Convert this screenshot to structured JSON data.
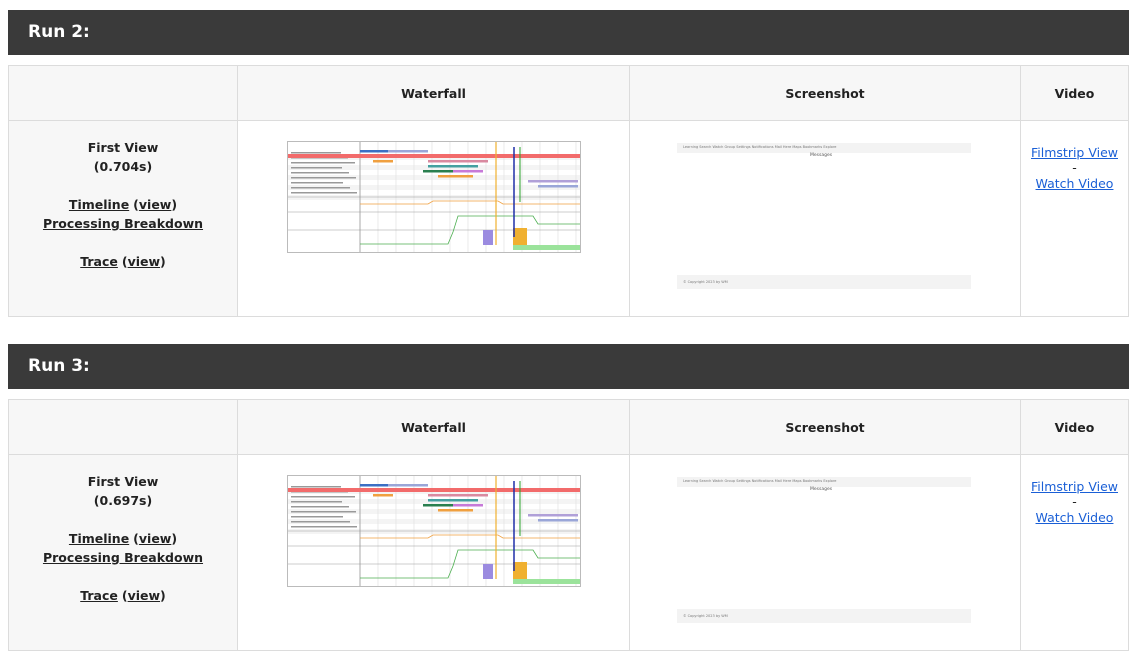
{
  "runs": [
    {
      "title": "Run 2:",
      "headers": {
        "waterfall": "Waterfall",
        "screenshot": "Screenshot",
        "video": "Video"
      },
      "view_label": "First View",
      "time": "(0.704s)",
      "timeline": "Timeline",
      "view_link": "view",
      "processing": "Processing Breakdown",
      "trace": "Trace",
      "filmstrip": "Filmstrip View",
      "dash": "-",
      "watch": "Watch Video",
      "screenshot_nav": "Learning   Search   Watch   Group   Settings   Notifications   Mail Here   Maps   Bookmarks   Explore",
      "screenshot_message": "Messages",
      "screenshot_footer": "© Copyright 2023 by WM"
    },
    {
      "title": "Run 3:",
      "headers": {
        "waterfall": "Waterfall",
        "screenshot": "Screenshot",
        "video": "Video"
      },
      "view_label": "First View",
      "time": "(0.697s)",
      "timeline": "Timeline",
      "view_link": "view",
      "processing": "Processing Breakdown",
      "trace": "Trace",
      "filmstrip": "Filmstrip View",
      "dash": "-",
      "watch": "Watch Video",
      "screenshot_nav": "Learning   Search   Watch   Group   Settings   Notifications   Mail Here   Maps   Bookmarks   Explore",
      "screenshot_message": "Messages",
      "screenshot_footer": "© Copyright 2023 by WM"
    }
  ],
  "colors": {
    "header_bg": "#3a3a3a",
    "link": "#1a5fd6",
    "cell_bg": "#f7f7f7"
  }
}
